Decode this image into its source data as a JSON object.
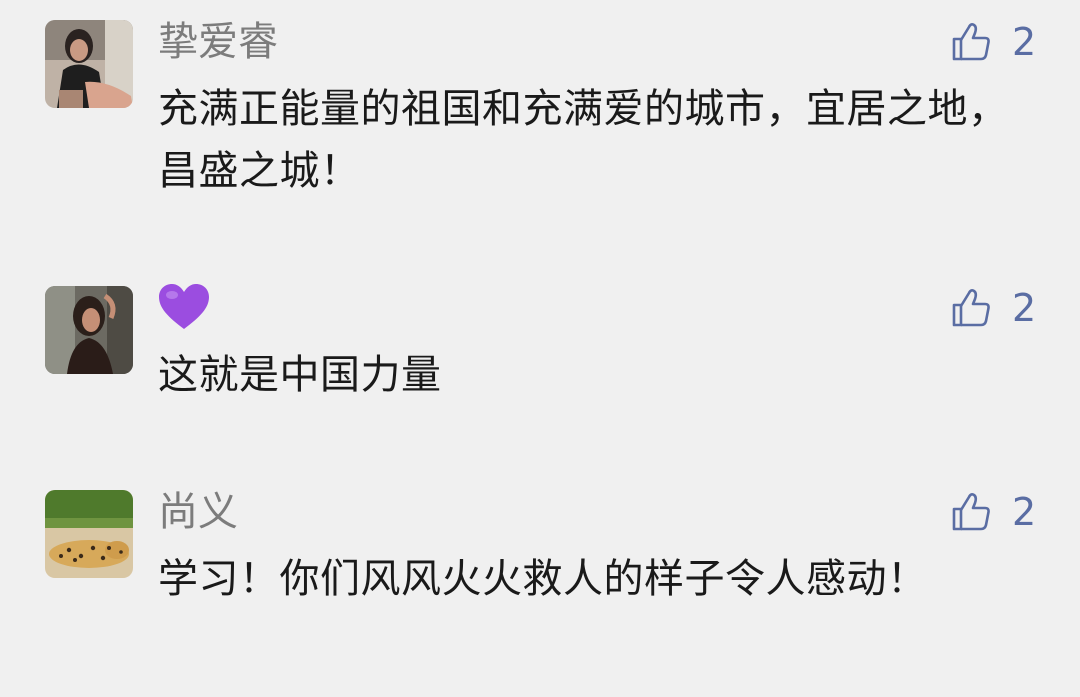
{
  "colors": {
    "background": "#f0f0f0",
    "username": "#7c7c7c",
    "like_accent": "#5a6da3",
    "text": "#1a1a1a",
    "heart": "#9b4de0"
  },
  "comments": [
    {
      "username": "挚爱睿",
      "like_icon": "thumbs-up-icon",
      "likes": "2",
      "text": "充满正能量的祖国和充满爱的城市，宜居之地，昌盛之城！"
    },
    {
      "username_emoji": "purple-heart-icon",
      "like_icon": "thumbs-up-icon",
      "likes": "2",
      "text": "这就是中国力量"
    },
    {
      "username": "尚义",
      "like_icon": "thumbs-up-icon",
      "likes": "2",
      "text": "学习！你们风风火火救人的样子令人感动！"
    }
  ]
}
